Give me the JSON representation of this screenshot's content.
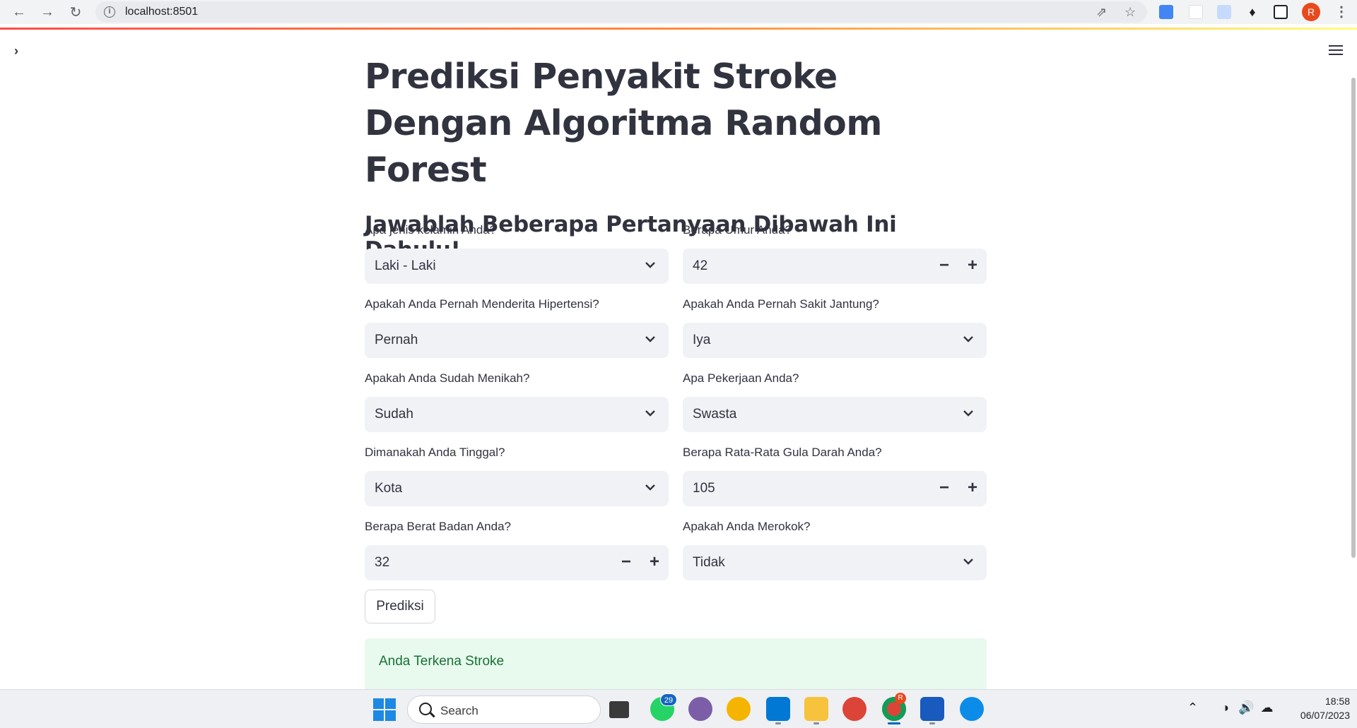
{
  "browser": {
    "url": "localhost:8501",
    "profile_initial": "R"
  },
  "app": {
    "title": "Prediksi Penyakit Stroke Dengan Algoritma Random Forest",
    "subheading": "Jawablah Beberapa Pertanyaan Dibawah Ini Dahulu!",
    "fields": [
      {
        "label": "Apa jenis kelamin Anda?",
        "type": "select",
        "value": "Laki - Laki"
      },
      {
        "label": "Berapa Umur Anda?",
        "type": "number",
        "value": "42"
      },
      {
        "label": "Apakah Anda Pernah Menderita Hipertensi?",
        "type": "select",
        "value": "Pernah"
      },
      {
        "label": "Apakah Anda Pernah Sakit Jantung?",
        "type": "select",
        "value": "Iya"
      },
      {
        "label": "Apakah Anda Sudah Menikah?",
        "type": "select",
        "value": "Sudah"
      },
      {
        "label": "Apa Pekerjaan Anda?",
        "type": "select",
        "value": "Swasta"
      },
      {
        "label": "Dimanakah Anda Tinggal?",
        "type": "select",
        "value": "Kota"
      },
      {
        "label": "Berapa Rata-Rata Gula Darah Anda?",
        "type": "number",
        "value": "105"
      },
      {
        "label": "Berapa Berat Badan Anda?",
        "type": "number",
        "value": "32"
      },
      {
        "label": "Apakah Anda Merokok?",
        "type": "select",
        "value": "Tidak"
      }
    ],
    "predict_button": "Prediksi",
    "result": "Anda Terkena Stroke",
    "result_color": "#177233",
    "accent": "#ff4b4b"
  },
  "taskbar": {
    "search_label": "Search",
    "whatsapp_badge": "29",
    "chrome_badge": "R",
    "time": "18:58",
    "date": "06/07/2023"
  }
}
